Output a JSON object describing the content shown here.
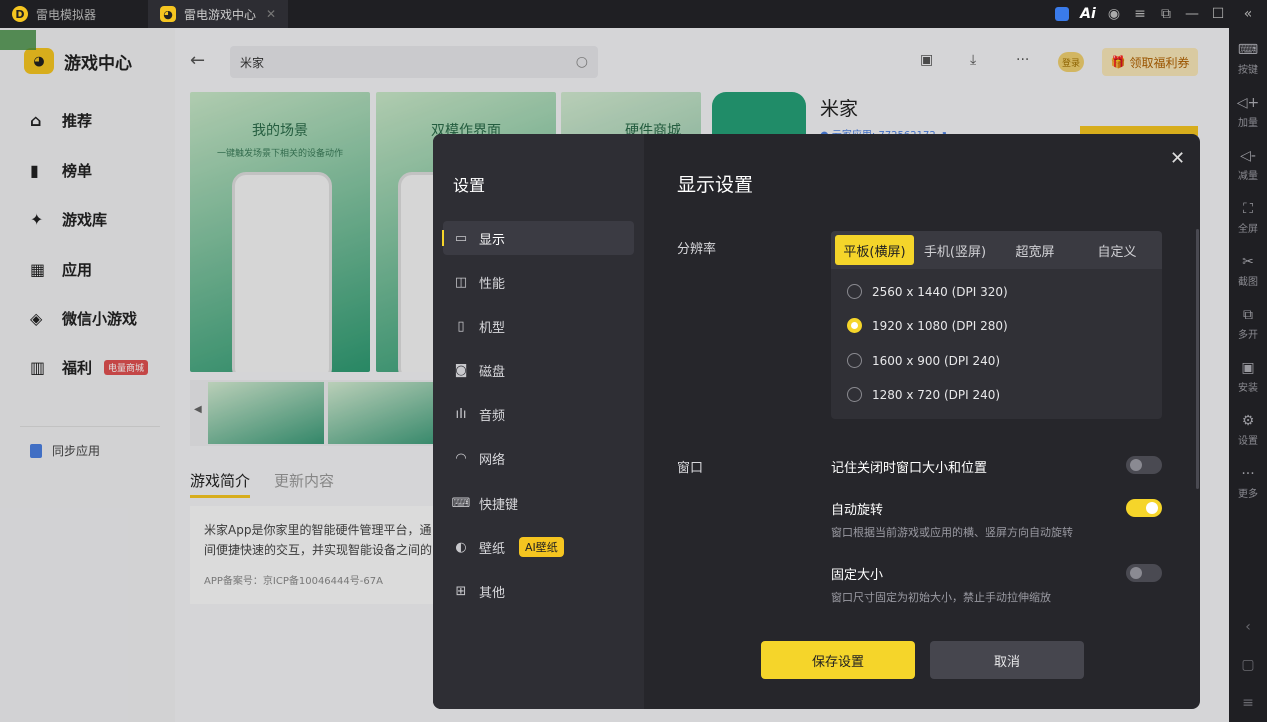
{
  "titlebar": {
    "tabs": [
      {
        "label": "雷电模拟器",
        "icon": "ldplayer-logo-icon"
      },
      {
        "label": "雷电游戏中心",
        "icon": "game-center-logo-icon"
      }
    ],
    "ai_label": "Ai"
  },
  "right_sidebar": [
    {
      "label": "按键",
      "icon": "keyboard-icon"
    },
    {
      "label": "加量",
      "icon": "volume-up-icon"
    },
    {
      "label": "减量",
      "icon": "volume-down-icon"
    },
    {
      "label": "全屏",
      "icon": "fullscreen-icon"
    },
    {
      "label": "截图",
      "icon": "scissors-icon"
    },
    {
      "label": "多开",
      "icon": "multi-instance-icon"
    },
    {
      "label": "安装",
      "icon": "apk-install-icon"
    },
    {
      "label": "设置",
      "icon": "settings-icon"
    },
    {
      "label": "更多",
      "icon": "more-icon"
    }
  ],
  "left_nav": {
    "brand": "游戏中心",
    "items": [
      {
        "label": "推荐",
        "icon": "home-icon"
      },
      {
        "label": "榜单",
        "icon": "ranking-icon"
      },
      {
        "label": "游戏库",
        "icon": "gamepad-icon"
      },
      {
        "label": "应用",
        "icon": "apps-icon"
      },
      {
        "label": "微信小游戏",
        "icon": "mini-game-icon"
      },
      {
        "label": "福利",
        "icon": "gift-icon",
        "badge": "电量商城"
      }
    ],
    "sync": "同步应用"
  },
  "topbar": {
    "search_value": "米家",
    "login": "登录",
    "welfare": "领取福利券"
  },
  "app_page": {
    "title": "米家",
    "subtitle": "● 云家应用: 772562172 ⬈",
    "shot_titles": [
      "我的场景",
      "双模作界面",
      "硬件商城"
    ],
    "shot_subtitle": "一键触发场景下相关的设备动作",
    "desc_tabs": [
      "游戏简介",
      "更新内容"
    ],
    "desc_lines": [
      "米家App是你家里的智能硬件管理平台，通",
      "间便捷快速的交互，并实现智能设备之间的"
    ],
    "icp": "APP备案号：京ICP备10046444号-67A"
  },
  "dialog": {
    "title": "设置",
    "section_title": "显示设置",
    "menu": [
      {
        "label": "显示",
        "icon": "monitor-icon",
        "active": true
      },
      {
        "label": "性能",
        "icon": "performance-icon"
      },
      {
        "label": "机型",
        "icon": "phone-model-icon"
      },
      {
        "label": "磁盘",
        "icon": "disk-icon"
      },
      {
        "label": "音频",
        "icon": "audio-icon"
      },
      {
        "label": "网络",
        "icon": "wifi-icon"
      },
      {
        "label": "快捷键",
        "icon": "keyboard-icon"
      },
      {
        "label": "壁纸",
        "icon": "palette-icon",
        "badge": "AI壁纸"
      },
      {
        "label": "其他",
        "icon": "grid-icon"
      }
    ],
    "resolution": {
      "label": "分辨率",
      "tabs": [
        "平板(横屏)",
        "手机(竖屏)",
        "超宽屏",
        "自定义"
      ],
      "active_tab": "平板(横屏)",
      "options": [
        "2560 x 1440  (DPI 320)",
        "1920 x 1080  (DPI 280)",
        "1600 x 900  (DPI 240)",
        "1280 x 720  (DPI 240)"
      ],
      "selected": "1920 x 1080  (DPI 280)"
    },
    "window": {
      "label": "窗口",
      "rows": [
        {
          "title": "记住关闭时窗口大小和位置",
          "desc": "",
          "on": false
        },
        {
          "title": "自动旋转",
          "desc": "窗口根据当前游戏或应用的横、竖屏方向自动旋转",
          "on": true
        },
        {
          "title": "固定大小",
          "desc": "窗口尺寸固定为初始大小，禁止手动拉伸缩放",
          "on": false
        }
      ]
    },
    "save": "保存设置",
    "cancel": "取消"
  },
  "colors": {
    "accent": "#f5d52a",
    "dialog_bg": "#26262b",
    "sidebar_bg": "#1f1f23"
  }
}
